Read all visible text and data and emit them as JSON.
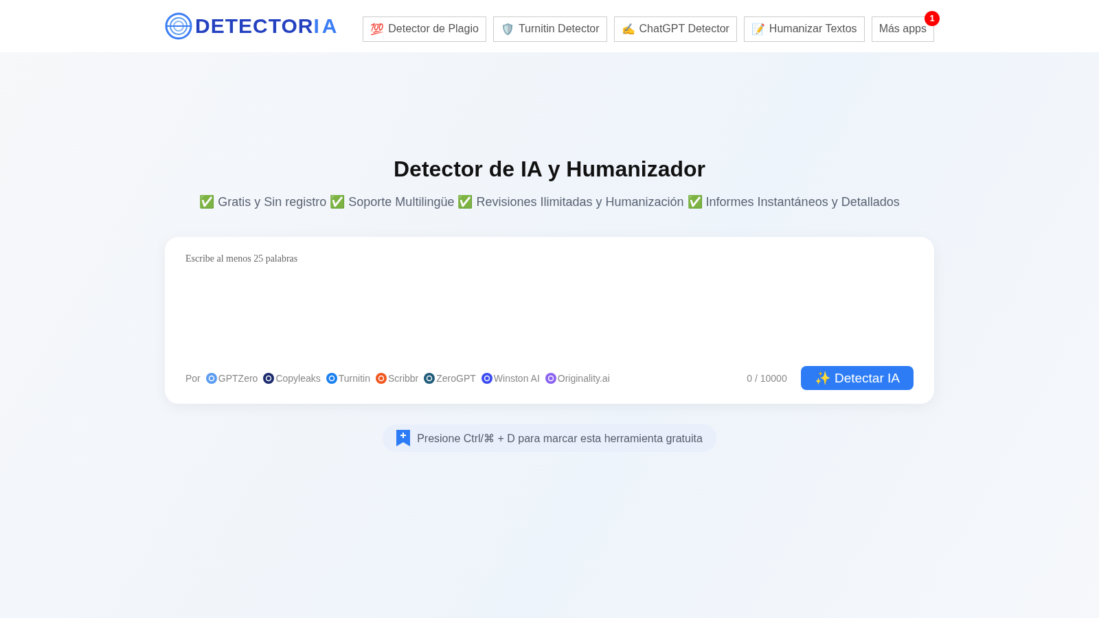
{
  "logo": {
    "text_main": "DETECTOR",
    "text_accent": "IA"
  },
  "nav": [
    {
      "icon": "💯",
      "label": "Detector de Plagio"
    },
    {
      "icon": "🛡️",
      "label": "Turnitin Detector"
    },
    {
      "icon": "✍️",
      "label": "ChatGPT Detector"
    },
    {
      "icon": "📝",
      "label": "Humanizar Textos"
    },
    {
      "label": "Más apps",
      "badge": "1"
    }
  ],
  "title": "Detector de IA y Humanizador",
  "subtitle": "✅ Gratis y Sin registro ✅ Soporte Multilingüe ✅ Revisiones Ilimitadas y Humanización ✅ Informes Instantáneos y Detallados",
  "editor": {
    "placeholder": "Escribe al menos 25 palabras",
    "by_label": "Por",
    "sources": [
      {
        "name": "GPTZero",
        "color": "#5b9cf0"
      },
      {
        "name": "Copyleaks",
        "color": "#1a2a6c"
      },
      {
        "name": "Turnitin",
        "color": "#1a7ff0"
      },
      {
        "name": "Scribbr",
        "color": "#f0561d"
      },
      {
        "name": "ZeroGPT",
        "color": "#1f5b7a"
      },
      {
        "name": "Winston AI",
        "color": "#3b4cf0"
      },
      {
        "name": "Originality.ai",
        "color": "#8a63f0"
      }
    ],
    "counter": "0 / 10000",
    "button": "✨ Detectar IA"
  },
  "bookmark_hint": "Presione Ctrl/⌘ + D para marcar esta herramienta gratuita"
}
